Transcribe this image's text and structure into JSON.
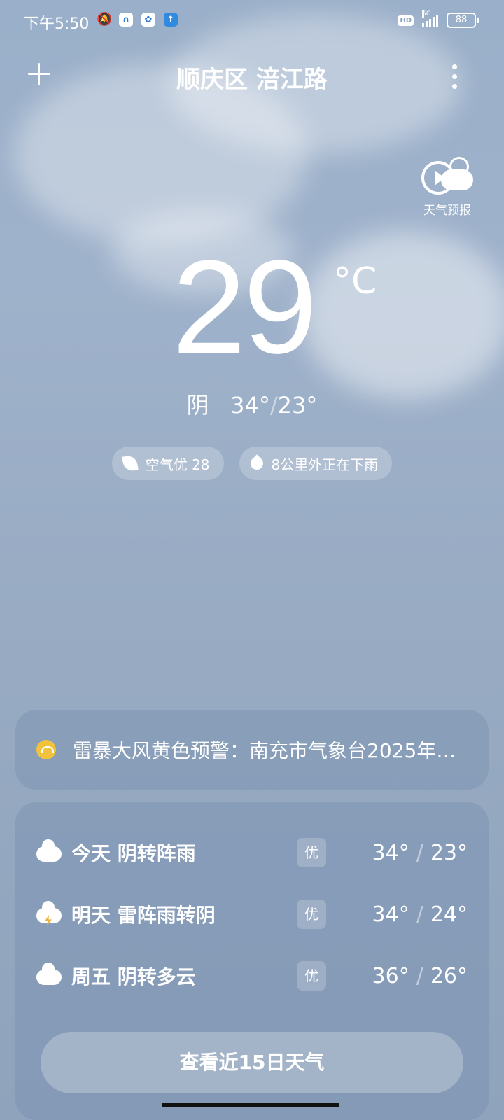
{
  "status_bar": {
    "time": "下午5:50",
    "battery": "88",
    "network": "5G",
    "hd": "HD"
  },
  "header": {
    "location": "顺庆区 涪江路",
    "forecast_video_label": "天气预报"
  },
  "current": {
    "temperature": "29",
    "unit": "°C",
    "condition": "阴",
    "high": "34°",
    "low": "23°",
    "chips": [
      {
        "icon": "leaf-icon",
        "text": "空气优 28"
      },
      {
        "icon": "raindrop-icon",
        "text": "8公里外正在下雨"
      }
    ]
  },
  "alert": {
    "icon": "warning-sun-icon",
    "text": "雷暴大风黄色预警：南充市气象台2025年…",
    "color": "#f2c23a"
  },
  "daily": [
    {
      "icon": "cloud-icon",
      "label": "今天  阴转阵雨",
      "aqi": "优",
      "high": "34°",
      "low": "23°"
    },
    {
      "icon": "thunder-cloud-icon",
      "label": "明天  雷阵雨转阴",
      "aqi": "优",
      "high": "34°",
      "low": "24°"
    },
    {
      "icon": "cloud-icon",
      "label": "周五  阴转多云",
      "aqi": "优",
      "high": "36°",
      "low": "26°"
    }
  ],
  "more_button": "查看近15日天气",
  "slash": "/"
}
